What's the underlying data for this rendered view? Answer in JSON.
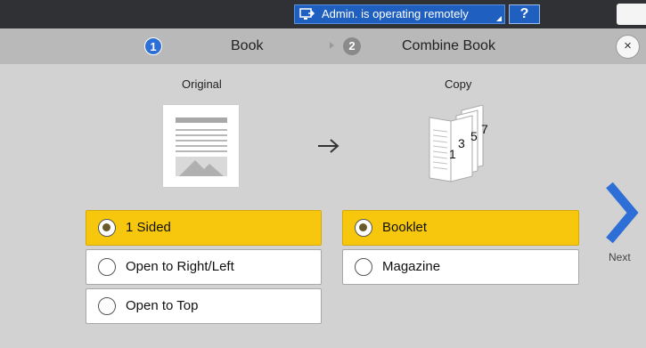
{
  "status_bar": {
    "remote_text": "Admin. is operating remotely",
    "help_label": "?"
  },
  "steps": [
    {
      "number": "1",
      "label": "Book"
    },
    {
      "number": "2",
      "label": "Combine Book"
    }
  ],
  "close_label": "×",
  "original": {
    "title": "Original"
  },
  "copy": {
    "title": "Copy",
    "page_numbers": [
      "1",
      "3",
      "5",
      "7"
    ]
  },
  "arrow": "→",
  "original_options": [
    {
      "label": "1 Sided",
      "selected": true
    },
    {
      "label": "Open to Right/Left",
      "selected": false
    },
    {
      "label": "Open to Top",
      "selected": false
    }
  ],
  "copy_options": [
    {
      "label": "Booklet",
      "selected": true
    },
    {
      "label": "Magazine",
      "selected": false
    }
  ],
  "next_label": "Next",
  "colors": {
    "accent_blue": "#2d6fd6",
    "selected_yellow": "#f7c70d"
  }
}
